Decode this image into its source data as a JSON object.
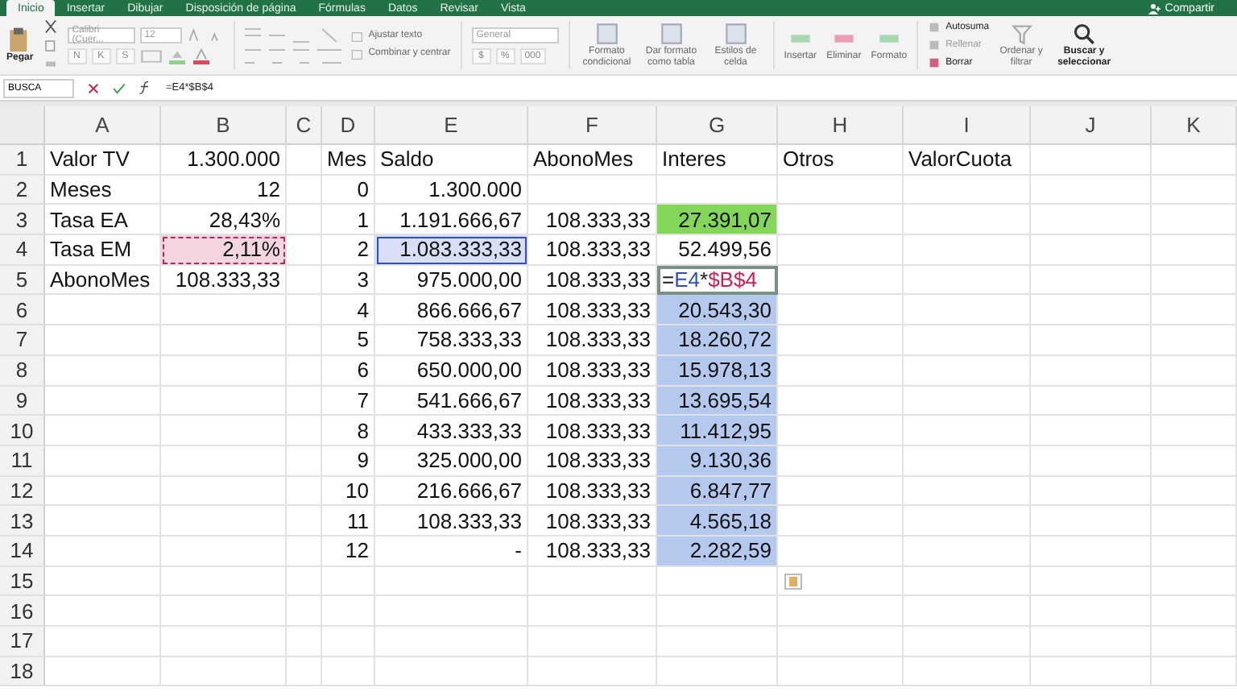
{
  "tabs": [
    {
      "label": "Inicio",
      "selected": true
    },
    {
      "label": "Insertar",
      "selected": false
    },
    {
      "label": "Dibujar",
      "selected": false
    },
    {
      "label": "Disposición de página",
      "selected": false
    },
    {
      "label": "Fórmulas",
      "selected": false
    },
    {
      "label": "Datos",
      "selected": false
    },
    {
      "label": "Revisar",
      "selected": false
    },
    {
      "label": "Vista",
      "selected": false
    }
  ],
  "share": "Compartir",
  "ribbon": {
    "paste": "Pegar",
    "font": "Calibri (Cuer...",
    "size": "12",
    "bold": "N",
    "italic": "K",
    "underline": "S",
    "wrap": "Ajustar texto",
    "merge": "Combinar y centrar",
    "number_format": "General",
    "currency": "$",
    "percent": "%",
    "thousands": "000",
    "styles": [
      "Formato condicional",
      "Dar formato como tabla",
      "Estilos de celda"
    ],
    "cells": [
      "Insertar",
      "Eliminar",
      "Formato"
    ],
    "editing": [
      "Autosuma",
      "Rellenar",
      "Borrar"
    ],
    "sort": "Ordenar y filtrar",
    "find": "Buscar y seleccionar"
  },
  "formula_bar": {
    "name_box": "BUSCA",
    "formula": "=E4*$B$4"
  },
  "columns": [
    "A",
    "B",
    "C",
    "D",
    "E",
    "F",
    "G",
    "H",
    "I",
    "J",
    "K"
  ],
  "rows": [
    {
      "number": "1",
      "cells": [
        {
          "text": "Valor TV",
          "kind": "text"
        },
        {
          "text": "1.300.000",
          "kind": "number"
        },
        null,
        {
          "text": "Mes",
          "kind": "text"
        },
        {
          "text": "Saldo",
          "kind": "text"
        },
        {
          "text": "AbonoMes",
          "kind": "text"
        },
        {
          "text": "Interes",
          "kind": "text"
        },
        {
          "text": "Otros",
          "kind": "text"
        },
        {
          "text": "ValorCuota",
          "kind": "text"
        },
        null,
        null
      ]
    },
    {
      "number": "2",
      "cells": [
        {
          "text": "Meses",
          "kind": "text"
        },
        {
          "text": "12",
          "kind": "number"
        },
        null,
        {
          "text": "0",
          "kind": "number"
        },
        {
          "text": "1.300.000",
          "kind": "number"
        },
        null,
        null,
        null,
        null,
        null,
        null
      ]
    },
    {
      "number": "3",
      "cells": [
        {
          "text": "Tasa EA",
          "kind": "text"
        },
        {
          "text": "28,43%",
          "kind": "number"
        },
        null,
        {
          "text": "1",
          "kind": "number"
        },
        {
          "text": "1.191.666,67",
          "kind": "number"
        },
        {
          "text": "108.333,33",
          "kind": "number"
        },
        {
          "text": "27.391,07",
          "kind": "number",
          "color": "#84d65a"
        },
        null,
        null,
        null,
        null
      ]
    },
    {
      "number": "4",
      "cells": [
        {
          "text": "Tasa EM",
          "kind": "text"
        },
        {
          "text": "2,11%",
          "kind": "number",
          "referenced": true,
          "marquee": true,
          "color": "#c0245a"
        },
        null,
        {
          "text": "2",
          "kind": "number"
        },
        {
          "text": "1.083.333,33",
          "kind": "number",
          "referenced": true,
          "color": "#2a4fc9"
        },
        {
          "text": "108.333,33",
          "kind": "number"
        },
        {
          "text": "52.499,56",
          "kind": "number"
        },
        null,
        null,
        null,
        null
      ]
    },
    {
      "number": "5",
      "cells": [
        {
          "text": "AbonoMes",
          "kind": "text"
        },
        {
          "text": "108.333,33",
          "kind": "number"
        },
        null,
        {
          "text": "3",
          "kind": "number"
        },
        {
          "text": "975.000,00",
          "kind": "number"
        },
        {
          "text": "108.333,33",
          "kind": "number"
        },
        {
          "kind": "formula",
          "editing": true,
          "parts": [
            {
              "text": "=",
              "color": "#222222"
            },
            {
              "text": "E4",
              "color": "#2a4fc9"
            },
            {
              "text": "*",
              "color": "#222222"
            },
            {
              "text": "$B$4",
              "color": "#c0245a"
            }
          ]
        },
        null,
        null,
        null,
        null
      ]
    },
    {
      "number": "6",
      "cells": [
        null,
        null,
        null,
        {
          "text": "4",
          "kind": "number"
        },
        {
          "text": "866.666,67",
          "kind": "number"
        },
        {
          "text": "108.333,33",
          "kind": "number"
        },
        {
          "text": "20.543,30",
          "kind": "number",
          "selected": true
        },
        null,
        null,
        null,
        null
      ]
    },
    {
      "number": "7",
      "cells": [
        null,
        null,
        null,
        {
          "text": "5",
          "kind": "number"
        },
        {
          "text": "758.333,33",
          "kind": "number"
        },
        {
          "text": "108.333,33",
          "kind": "number"
        },
        {
          "text": "18.260,72",
          "kind": "number",
          "selected": true
        },
        null,
        null,
        null,
        null
      ]
    },
    {
      "number": "8",
      "cells": [
        null,
        null,
        null,
        {
          "text": "6",
          "kind": "number"
        },
        {
          "text": "650.000,00",
          "kind": "number"
        },
        {
          "text": "108.333,33",
          "kind": "number"
        },
        {
          "text": "15.978,13",
          "kind": "number",
          "selected": true
        },
        null,
        null,
        null,
        null
      ]
    },
    {
      "number": "9",
      "cells": [
        null,
        null,
        null,
        {
          "text": "7",
          "kind": "number"
        },
        {
          "text": "541.666,67",
          "kind": "number"
        },
        {
          "text": "108.333,33",
          "kind": "number"
        },
        {
          "text": "13.695,54",
          "kind": "number",
          "selected": true
        },
        null,
        null,
        null,
        null
      ]
    },
    {
      "number": "10",
      "cells": [
        null,
        null,
        null,
        {
          "text": "8",
          "kind": "number"
        },
        {
          "text": "433.333,33",
          "kind": "number"
        },
        {
          "text": "108.333,33",
          "kind": "number"
        },
        {
          "text": "11.412,95",
          "kind": "number",
          "selected": true
        },
        null,
        null,
        null,
        null
      ]
    },
    {
      "number": "11",
      "cells": [
        null,
        null,
        null,
        {
          "text": "9",
          "kind": "number"
        },
        {
          "text": "325.000,00",
          "kind": "number"
        },
        {
          "text": "108.333,33",
          "kind": "number"
        },
        {
          "text": "9.130,36",
          "kind": "number",
          "selected": true
        },
        null,
        null,
        null,
        null
      ]
    },
    {
      "number": "12",
      "cells": [
        null,
        null,
        null,
        {
          "text": "10",
          "kind": "number"
        },
        {
          "text": "216.666,67",
          "kind": "number"
        },
        {
          "text": "108.333,33",
          "kind": "number"
        },
        {
          "text": "6.847,77",
          "kind": "number",
          "selected": true
        },
        null,
        null,
        null,
        null
      ]
    },
    {
      "number": "13",
      "cells": [
        null,
        null,
        null,
        {
          "text": "11",
          "kind": "number"
        },
        {
          "text": "108.333,33",
          "kind": "number"
        },
        {
          "text": "108.333,33",
          "kind": "number"
        },
        {
          "text": "4.565,18",
          "kind": "number",
          "selected": true
        },
        null,
        null,
        null,
        null
      ]
    },
    {
      "number": "14",
      "cells": [
        null,
        null,
        null,
        {
          "text": "12",
          "kind": "number"
        },
        {
          "text": "-",
          "kind": "number"
        },
        {
          "text": "108.333,33",
          "kind": "number"
        },
        {
          "text": "2.282,59",
          "kind": "number",
          "selected": true
        },
        null,
        null,
        null,
        null
      ]
    },
    {
      "number": "15",
      "cells": [
        null,
        null,
        null,
        null,
        null,
        null,
        null,
        {
          "kind": "paste-options"
        },
        null,
        null,
        null
      ]
    },
    {
      "number": "16",
      "cells": [
        null,
        null,
        null,
        null,
        null,
        null,
        null,
        null,
        null,
        null,
        null
      ]
    },
    {
      "number": "17",
      "cells": [
        null,
        null,
        null,
        null,
        null,
        null,
        null,
        null,
        null,
        null,
        null
      ]
    },
    {
      "number": "18",
      "cells": [
        null,
        null,
        null,
        null,
        null,
        null,
        null,
        null,
        null,
        null,
        null
      ]
    }
  ]
}
